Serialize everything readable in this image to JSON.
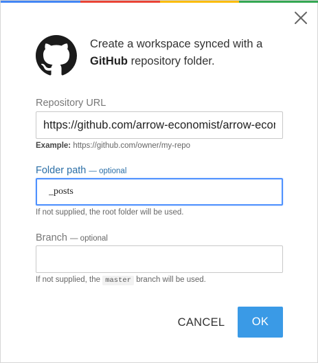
{
  "colors": {
    "accent_strip": [
      "#4285f4",
      "#ea4335",
      "#fbbc05",
      "#34a853"
    ],
    "link_label": "#2a6ea6",
    "focus_border": "#4d90fe",
    "primary_button": "#3a9ae6"
  },
  "dialog": {
    "close_icon": "close-icon",
    "logo_icon": "github-logo-icon",
    "header_text_before": "Create a workspace synced with a ",
    "header_text_bold": "GitHub",
    "header_text_after": " repository folder."
  },
  "repository_url": {
    "label": "Repository URL",
    "value": "https://github.com/arrow-economist/arrow-economist",
    "example_prefix": "Example:",
    "example_value": "https://github.com/owner/my-repo"
  },
  "folder_path": {
    "label": "Folder path",
    "optional": "— optional",
    "value": "_posts",
    "hint": "If not supplied, the root folder will be used."
  },
  "branch": {
    "label": "Branch",
    "optional": "— optional",
    "value": "",
    "hint_before": "If not supplied, the ",
    "hint_code": "master",
    "hint_after": " branch will be used."
  },
  "buttons": {
    "cancel": "CANCEL",
    "ok": "OK"
  }
}
